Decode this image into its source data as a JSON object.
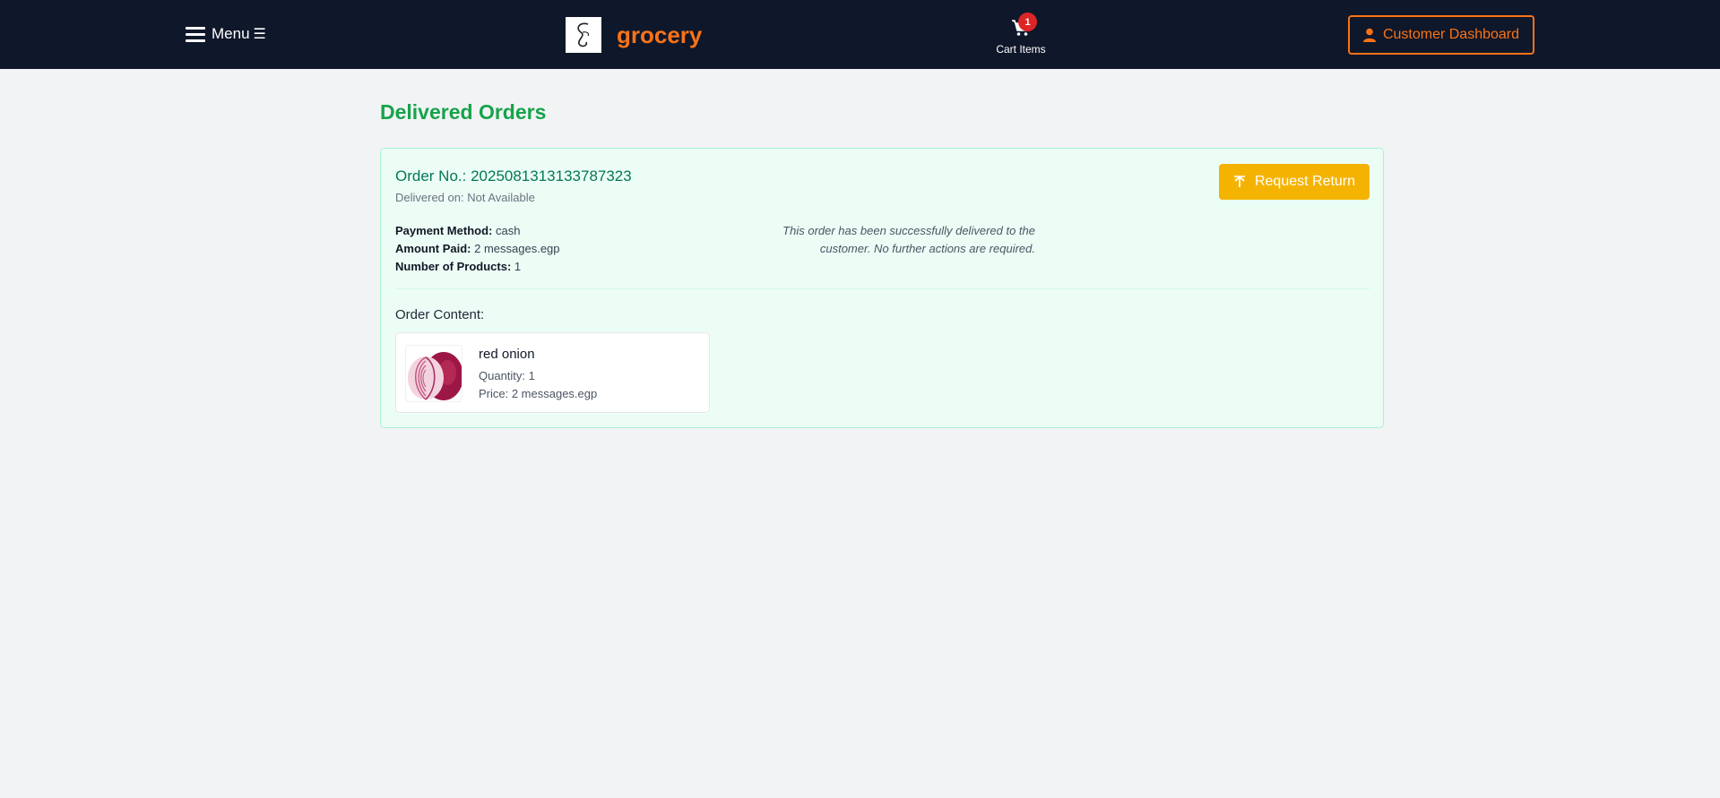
{
  "header": {
    "menu_label": "Menu",
    "menu_glyph": "☰",
    "brand_name": "grocery",
    "cart_count": "1",
    "cart_label": "Cart Items",
    "dashboard_label": "Customer Dashboard"
  },
  "page": {
    "title": "Delivered Orders"
  },
  "order": {
    "number_text": "Order No.: 2025081313133787323",
    "delivered_text": "Delivered on: Not Available",
    "return_label": "Request Return",
    "payment_label": "Payment Method:",
    "payment_value": "cash",
    "amount_label": "Amount Paid:",
    "amount_value": "2 messages.egp",
    "count_label": "Number of Products:",
    "count_value": "1",
    "note": "This order has been successfully delivered to the customer. No further actions are required.",
    "content_title": "Order Content:",
    "items": [
      {
        "name": "red onion",
        "quantity_text": "Quantity: 1",
        "price_text": "Price: 2 messages.egp",
        "image_icon": "red-onion-image"
      }
    ]
  },
  "colors": {
    "topbar": "#0f172a",
    "brand": "#f97316",
    "title_green": "#16a34a",
    "order_green": "#047857",
    "return_button": "#f5b301",
    "badge": "#dc2626"
  },
  "icons": [
    "hamburger-icon",
    "cart-icon",
    "user-icon",
    "arrow-up-icon"
  ]
}
